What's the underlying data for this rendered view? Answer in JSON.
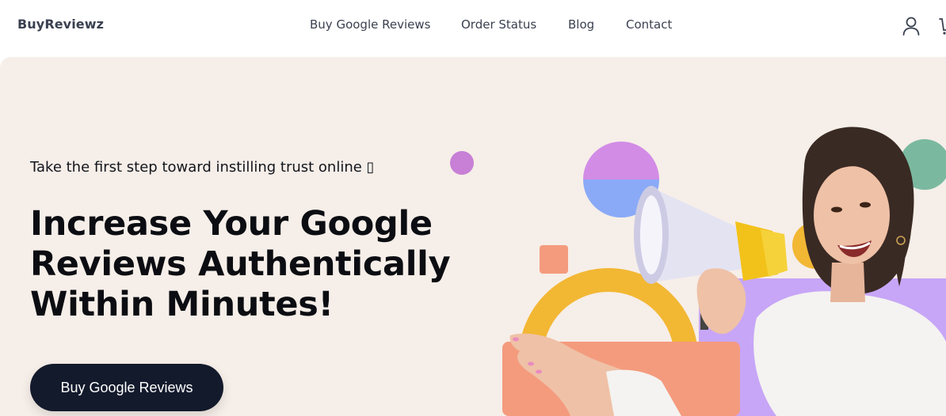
{
  "brand": {
    "name": "BuyReviewz"
  },
  "nav": {
    "links": [
      "Buy Google Reviews",
      "Order Status",
      "Blog",
      "Contact"
    ]
  },
  "header_icons": [
    "user-icon",
    "cart-icon"
  ],
  "hero": {
    "eyebrow": "Take the first step toward instilling trust online ▯",
    "headline_lines": [
      "Increase Your Google",
      "Reviews Authentically",
      "Within Minutes!"
    ],
    "cta_label": "Buy Google Reviews"
  },
  "colors": {
    "hero_bg": "#f6eee8",
    "cta_bg": "#131a2c",
    "purple_dot": "#c87fd6",
    "orange_square": "#f49b7e",
    "yellow_ring": "#f2b733",
    "teal_dot": "#7ab9a0",
    "lavender_panel": "#c7a6f7",
    "salmon_panel": "#f49b7e",
    "circle_top": "#d28ce6",
    "circle_bottom": "#8aaaf7"
  }
}
